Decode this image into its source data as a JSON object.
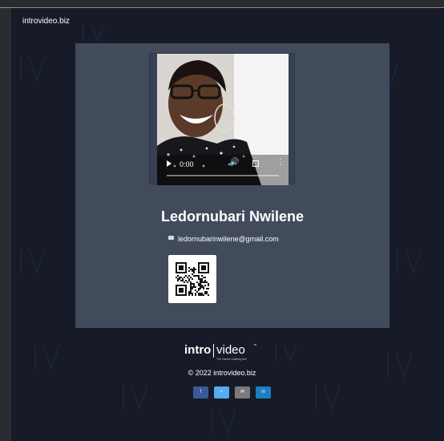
{
  "header": {
    "site_name": "introvideo.biz"
  },
  "profile": {
    "name": "Ledornubari Nwilene",
    "email": "ledornubarinwilene@gmail.com"
  },
  "video": {
    "current_time": "0:00",
    "progress": 0.0
  },
  "footer": {
    "logo_intro": "intro",
    "logo_video": "video",
    "logo_tagline": "The Career building tool",
    "logo_tm": "™",
    "copyright": "© 2022 introvideo.biz",
    "social": [
      {
        "label": "f",
        "icon": "facebook-icon",
        "color": "#3b5998"
      },
      {
        "label": "✓",
        "icon": "twitter-icon",
        "color": "#55acee"
      },
      {
        "label": "✉",
        "icon": "email-icon",
        "color": "#7a7a7a"
      },
      {
        "label": "in",
        "icon": "linkedin-icon",
        "color": "#1d7fbf"
      }
    ]
  },
  "colors": {
    "page_bg": "#161b27",
    "card_bg": "#414b5c",
    "text": "#ffffff"
  }
}
